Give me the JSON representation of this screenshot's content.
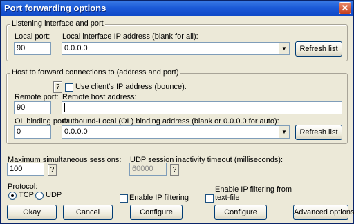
{
  "window": {
    "title": "Port forwarding options",
    "close_glyph": "✕"
  },
  "listen": {
    "group_label": "Listening interface and port",
    "local_port_label": "Local port:",
    "local_port_value": "90",
    "iface_label": "Local interface IP address (blank for all):",
    "iface_value": "0.0.0.0",
    "refresh_label": "Refresh list"
  },
  "host": {
    "group_label": "Host to forward connections to (address and port)",
    "use_client_ip_label": "Use client's IP address (bounce).",
    "remote_port_label": "Remote port:",
    "remote_port_value": "90",
    "remote_host_label": "Remote host address:",
    "remote_host_value": "",
    "ol_port_label": "OL binding port:",
    "ol_port_value": "0",
    "ol_addr_label": "Outbound-Local (OL) binding address (blank or 0.0.0.0 for auto):",
    "ol_addr_value": "0.0.0.0",
    "refresh_label": "Refresh list",
    "help_glyph": "?"
  },
  "sessions": {
    "max_label": "Maximum simultaneous sessions:",
    "max_value": "100",
    "udp_label": "UDP session inactivity timeout (milliseconds):",
    "udp_value": "60000",
    "help_glyph": "?"
  },
  "protocol": {
    "label": "Protocol:",
    "tcp_label": "TCP",
    "udp_label": "UDP",
    "selected": "TCP"
  },
  "filters": {
    "enable_ip_label": "Enable IP filtering",
    "enable_text_label_1": "Enable IP filtering from",
    "enable_text_label_2": "text-file"
  },
  "buttons": {
    "okay": "Okay",
    "cancel": "Cancel",
    "configure1": "Configure",
    "configure2": "Configure",
    "advanced": "Advanced options"
  },
  "icons": {
    "dropdown": "▼"
  }
}
